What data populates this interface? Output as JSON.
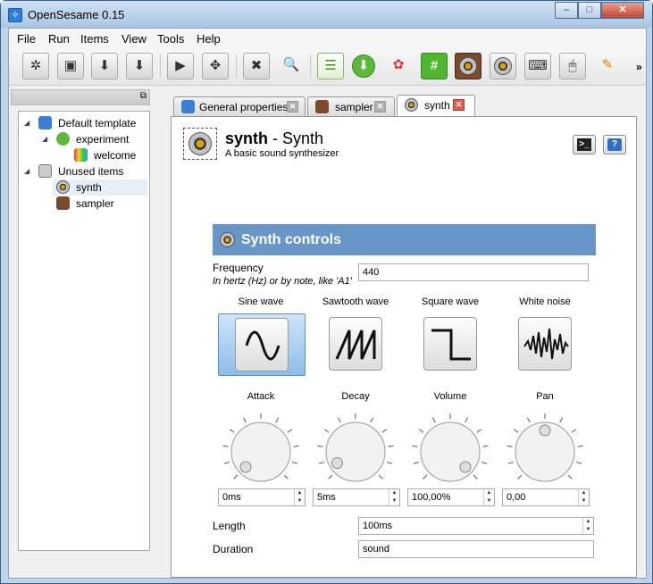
{
  "window": {
    "title": "OpenSesame 0.15",
    "min": "–",
    "max": "□",
    "close": "✕"
  },
  "menu": [
    "File",
    "Run",
    "Items",
    "View",
    "Tools",
    "Help"
  ],
  "toolbar": {
    "buttons": [
      "new-icon",
      "open-icon",
      "save-icon",
      "save-as-icon",
      "run-icon",
      "run-fullscreen-icon",
      "kill-icon",
      "inspect-icon",
      "sequence-icon",
      "loop-icon",
      "sketchpad-icon",
      "logger-icon",
      "sampler-icon",
      "synth-icon",
      "keyboard-icon",
      "mouse-icon",
      "notepad-icon"
    ],
    "more": "»"
  },
  "dock": {
    "float": "⧉"
  },
  "tree": [
    {
      "label": "Default template",
      "expanded": true,
      "icon": "sequence-icon"
    },
    {
      "label": "experiment",
      "expanded": true,
      "icon": "loop-icon"
    },
    {
      "label": "welcome",
      "icon": "sketchpad-icon"
    },
    {
      "label": "Unused items",
      "expanded": true,
      "icon": "trash-icon"
    },
    {
      "label": "synth",
      "icon": "synth-icon",
      "selected": true
    },
    {
      "label": "sampler",
      "icon": "sampler-icon"
    }
  ],
  "tabs": [
    {
      "label": "General properties",
      "icon": "general-icon"
    },
    {
      "label": "sampler",
      "icon": "sampler-icon"
    },
    {
      "label": "synth",
      "icon": "synth-icon",
      "active": true
    }
  ],
  "header": {
    "name": "synth",
    "separator": " - ",
    "type": "Synth",
    "description": "A basic sound synthesizer"
  },
  "synth": {
    "section_title": "Synth controls",
    "frequency": {
      "label": "Frequency",
      "hint": "In hertz (Hz) or by note, like 'A1'",
      "value": "440"
    },
    "waves": [
      {
        "label": "Sine wave",
        "selected": true
      },
      {
        "label": "Sawtooth wave"
      },
      {
        "label": "Square wave"
      },
      {
        "label": "White noise"
      }
    ],
    "knobs": [
      {
        "label": "Attack",
        "value": "0ms",
        "level": 0
      },
      {
        "label": "Decay",
        "value": "5ms",
        "level": 0.05
      },
      {
        "label": "Volume",
        "value": "100,00%",
        "level": 1
      },
      {
        "label": "Pan",
        "value": "0,00",
        "level": 0.5
      }
    ],
    "length": {
      "label": "Length",
      "value": "100ms"
    },
    "duration": {
      "label": "Duration",
      "value": "sound"
    }
  },
  "colors": {
    "accent": "#6896c9",
    "close_tab": "#e35d4a"
  }
}
